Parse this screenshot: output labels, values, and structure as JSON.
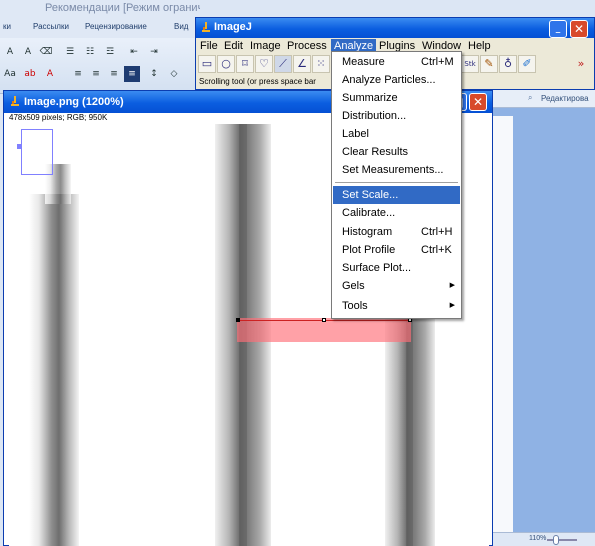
{
  "word": {
    "title": "Рекомендации [Режим ограничен",
    "tabs": [
      "ки",
      "Рассылки",
      "Рецензирование",
      "Вид"
    ],
    "right_panel_label": "Редактирова",
    "zoom": "110%"
  },
  "imagej": {
    "title": "ImageJ",
    "menubar": [
      "File",
      "Edit",
      "Image",
      "Process",
      "Analyze",
      "Plugins",
      "Window",
      "Help"
    ],
    "active_menu": "Analyze",
    "status": "Scrolling tool (or press space bar",
    "toolbar_extra": "Stk",
    "more_tools": "»"
  },
  "analyze_menu": {
    "items": [
      {
        "label": "Measure",
        "shortcut": "Ctrl+M"
      },
      {
        "label": "Analyze Particles..."
      },
      {
        "label": "Summarize"
      },
      {
        "label": "Distribution..."
      },
      {
        "label": "Label"
      },
      {
        "label": "Clear Results"
      },
      {
        "label": "Set Measurements..."
      },
      {
        "label": "Set Scale...",
        "selected": true
      },
      {
        "label": "Calibrate..."
      },
      {
        "label": "Histogram",
        "shortcut": "Ctrl+H"
      },
      {
        "label": "Plot Profile",
        "shortcut": "Ctrl+K"
      },
      {
        "label": "Surface Plot..."
      },
      {
        "label": "Gels",
        "submenu": true
      },
      {
        "label": "Tools",
        "submenu": true
      }
    ],
    "colors": {
      "highlight": "#316ac5"
    }
  },
  "image_window": {
    "title": "Image.png (1200%)",
    "info": "478x509 pixels; RGB; 950K"
  },
  "colors": {
    "xp_blue": "#0b5ee0",
    "selection": "#ff6e78"
  }
}
